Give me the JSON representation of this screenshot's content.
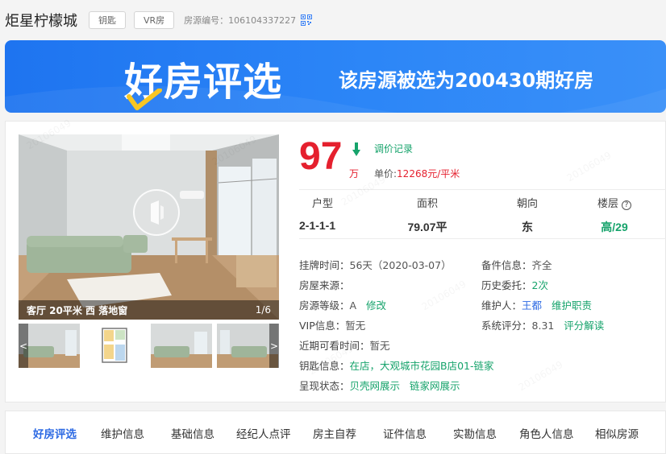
{
  "header": {
    "community_name": "炬星柠檬城",
    "tags": [
      "钥匙",
      "VR房"
    ],
    "house_code_label": "房源编号：",
    "house_code": "106104337227"
  },
  "banner": {
    "logo_text": "好房评选",
    "message": "该房源被选为200430期好房"
  },
  "photo": {
    "caption": "客厅 20平米 西 落地窗",
    "index": "1/6",
    "prev_arrow": "<",
    "next_arrow": ">"
  },
  "price": {
    "total": "97",
    "unit": "万",
    "history_link": "调价记录",
    "unit_price_label": "单价:",
    "unit_price_value": "12268元/平米"
  },
  "stats": [
    {
      "label": "户型",
      "value": "2-1-1-1"
    },
    {
      "label": "面积",
      "value": "79.07平"
    },
    {
      "label": "朝向",
      "value": "东"
    },
    {
      "label": "楼层",
      "value": "高/29"
    }
  ],
  "info": {
    "listing_time_label": "挂牌时间：",
    "listing_time_value": "56天（2020-03-07）",
    "source_label": "房屋来源：",
    "grade_label": "房源等级：",
    "grade_value": "A",
    "grade_edit": "修改",
    "vip_label": "VIP信息：",
    "vip_value": "暂无",
    "viewing_label": "近期可看时间：",
    "viewing_value": "暂无",
    "key_label": "钥匙信息：",
    "key_value": "在店，大观城市花园B店01-链家",
    "display_label": "呈现状态：",
    "display_beike": "贝壳网展示",
    "display_lianjia": "链家网展示",
    "docs_label": "备件信息：",
    "docs_value": "齐全",
    "history_label": "历史委托：",
    "history_value": "2次",
    "maintainer_label": "维护人：",
    "maintainer_name": "王都",
    "maintainer_duty": "维护职责",
    "score_label": "系统评分：",
    "score_value": "8.31",
    "score_link": "评分解读"
  },
  "nav": {
    "items": [
      "好房评选",
      "维护信息",
      "基础信息",
      "经纪人点评",
      "房主自荐",
      "证件信息",
      "实勘信息",
      "角色人信息",
      "相似房源"
    ]
  },
  "watermark": "20106049",
  "colors": {
    "price_red": "#e5202e",
    "link_green": "#16a36b",
    "brand_blue": "#2c86f7",
    "nav_active_blue": "#2d6ae3"
  }
}
